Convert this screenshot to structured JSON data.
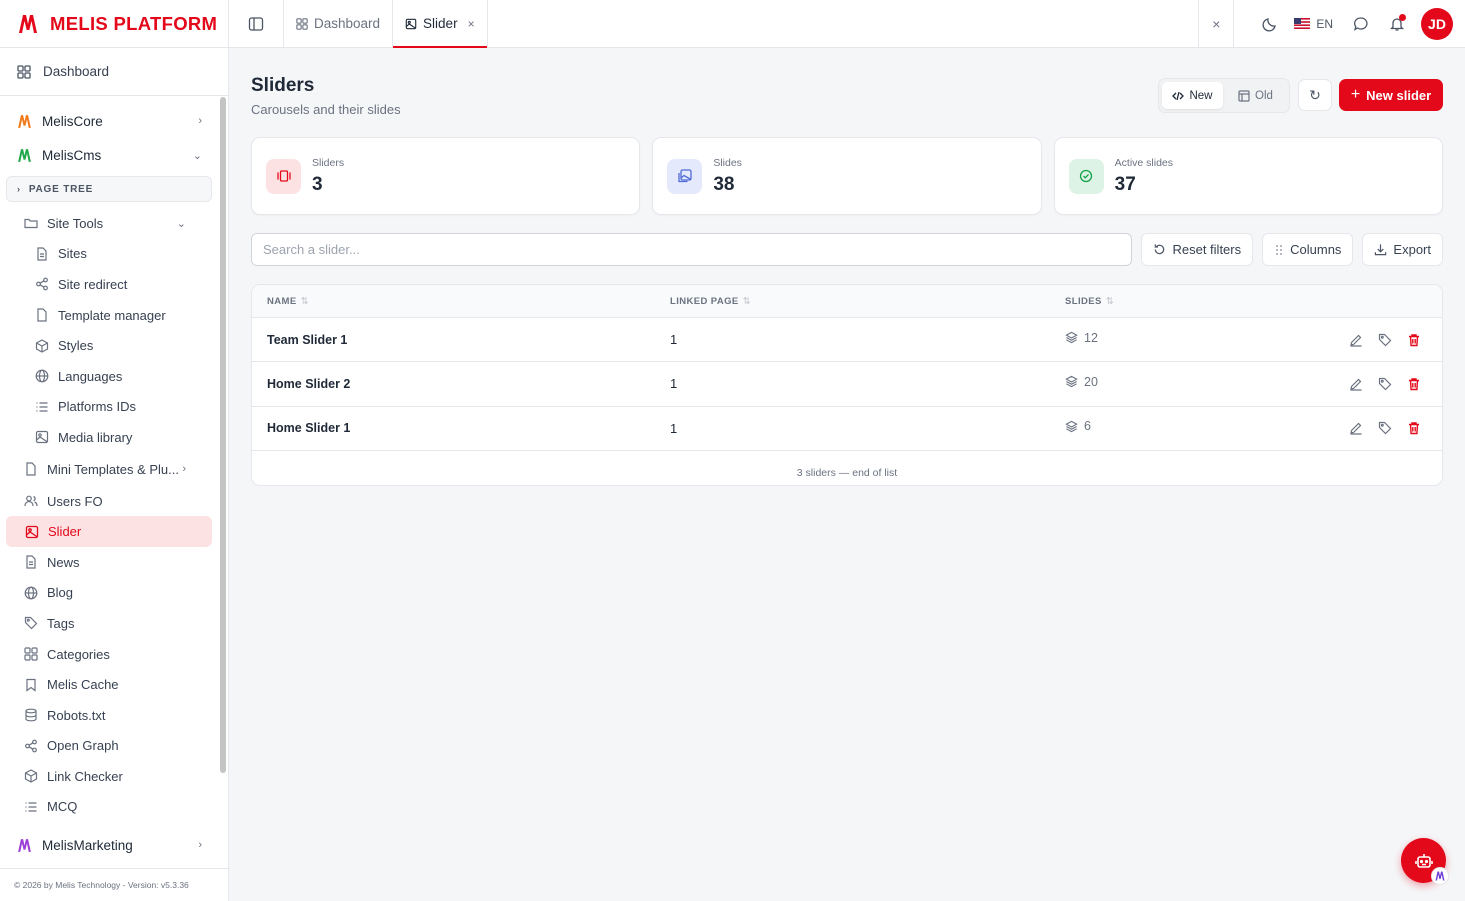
{
  "brand": {
    "name": "MELIS PLATFORM",
    "accent": "#e3091a"
  },
  "sidebar": {
    "dashboard": "Dashboard",
    "modules": {
      "core": "MelisCore",
      "cms": "MelisCms",
      "marketing": "MelisMarketing"
    },
    "page_tree": "PAGE TREE",
    "site_tools": "Site Tools",
    "site_tools_items": [
      "Sites",
      "Site redirect",
      "Template manager",
      "Styles",
      "Languages",
      "Platforms IDs",
      "Media library"
    ],
    "items": [
      "Mini Templates & Plu...",
      "Users FO",
      "Slider",
      "News",
      "Blog",
      "Tags",
      "Categories",
      "Melis Cache",
      "Robots.txt",
      "Open Graph",
      "Link Checker",
      "MCQ"
    ],
    "active_item": "Slider",
    "footer": "© 2026 by Melis Technology - Version: v5.3.36"
  },
  "topbar": {
    "tabs": [
      {
        "label": "Dashboard"
      },
      {
        "label": "Slider",
        "close": "×"
      }
    ],
    "close_all": "×",
    "language": "EN",
    "avatar_initials": "JD"
  },
  "page": {
    "title": "Sliders",
    "subtitle": "Carousels and their slides",
    "view_new": "New",
    "view_old": "Old",
    "refresh": "↻",
    "new_button": "New slider",
    "new_button_icon": "+"
  },
  "stats": [
    {
      "label": "Sliders",
      "value": "3",
      "color": "#e3091a",
      "bg": "#fde2e4"
    },
    {
      "label": "Slides",
      "value": "38",
      "color": "#4f6bd8",
      "bg": "#e4e9fb"
    },
    {
      "label": "Active slides",
      "value": "37",
      "color": "#16a34a",
      "bg": "#ddf3e6"
    }
  ],
  "toolbar": {
    "search_placeholder": "Search a slider...",
    "reset": "Reset filters",
    "columns": "Columns",
    "export": "Export"
  },
  "table": {
    "columns": [
      "NAME",
      "LINKED PAGE",
      "SLIDES"
    ],
    "sort_glyph": "⇅",
    "rows": [
      {
        "name": "Team Slider 1",
        "linked_page": "1",
        "slides": "12"
      },
      {
        "name": "Home Slider 2",
        "linked_page": "1",
        "slides": "20"
      },
      {
        "name": "Home Slider 1",
        "linked_page": "1",
        "slides": "6"
      }
    ],
    "footer_note": "3 sliders — end of list"
  }
}
